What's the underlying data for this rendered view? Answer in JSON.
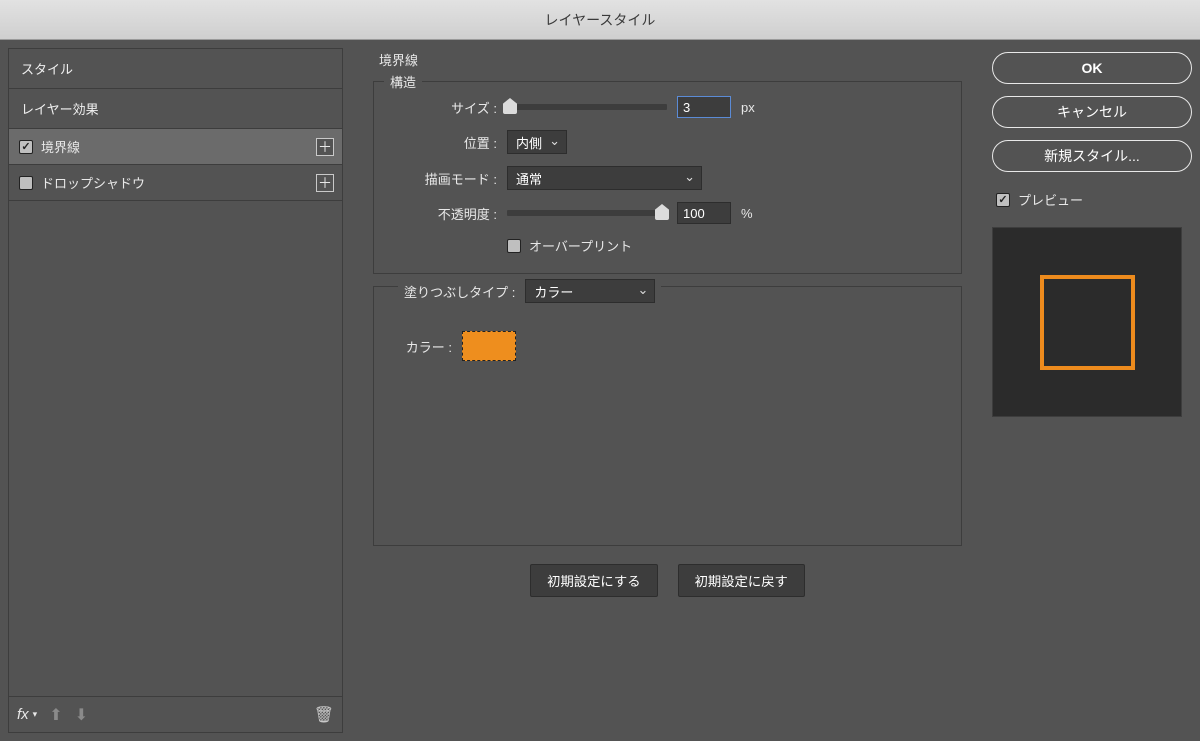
{
  "title": "レイヤースタイル",
  "sidebar": {
    "header": "スタイル",
    "layer_effects_label": "レイヤー効果",
    "items": [
      {
        "label": "境界線",
        "checked": true,
        "selected": true,
        "has_plus": true
      },
      {
        "label": "ドロップシャドウ",
        "checked": false,
        "selected": false,
        "has_plus": true
      }
    ],
    "fx_label": "fx"
  },
  "stroke": {
    "section_title": "境界線",
    "structure_label": "構造",
    "size_label": "サイズ :",
    "size_value": "3",
    "size_unit": "px",
    "position_label": "位置 :",
    "position_value": "内側",
    "blend_label": "描画モード :",
    "blend_value": "通常",
    "opacity_label": "不透明度 :",
    "opacity_value": "100",
    "opacity_unit": "%",
    "overprint_label": "オーバープリント",
    "fill_type_label": "塗りつぶしタイプ :",
    "fill_type_value": "カラー",
    "color_label": "カラー :",
    "color_value": "#ee8e1e"
  },
  "buttons": {
    "make_default": "初期設定にする",
    "reset_default": "初期設定に戻す",
    "ok": "OK",
    "cancel": "キャンセル",
    "new_style": "新規スタイル...",
    "preview": "プレビュー"
  }
}
